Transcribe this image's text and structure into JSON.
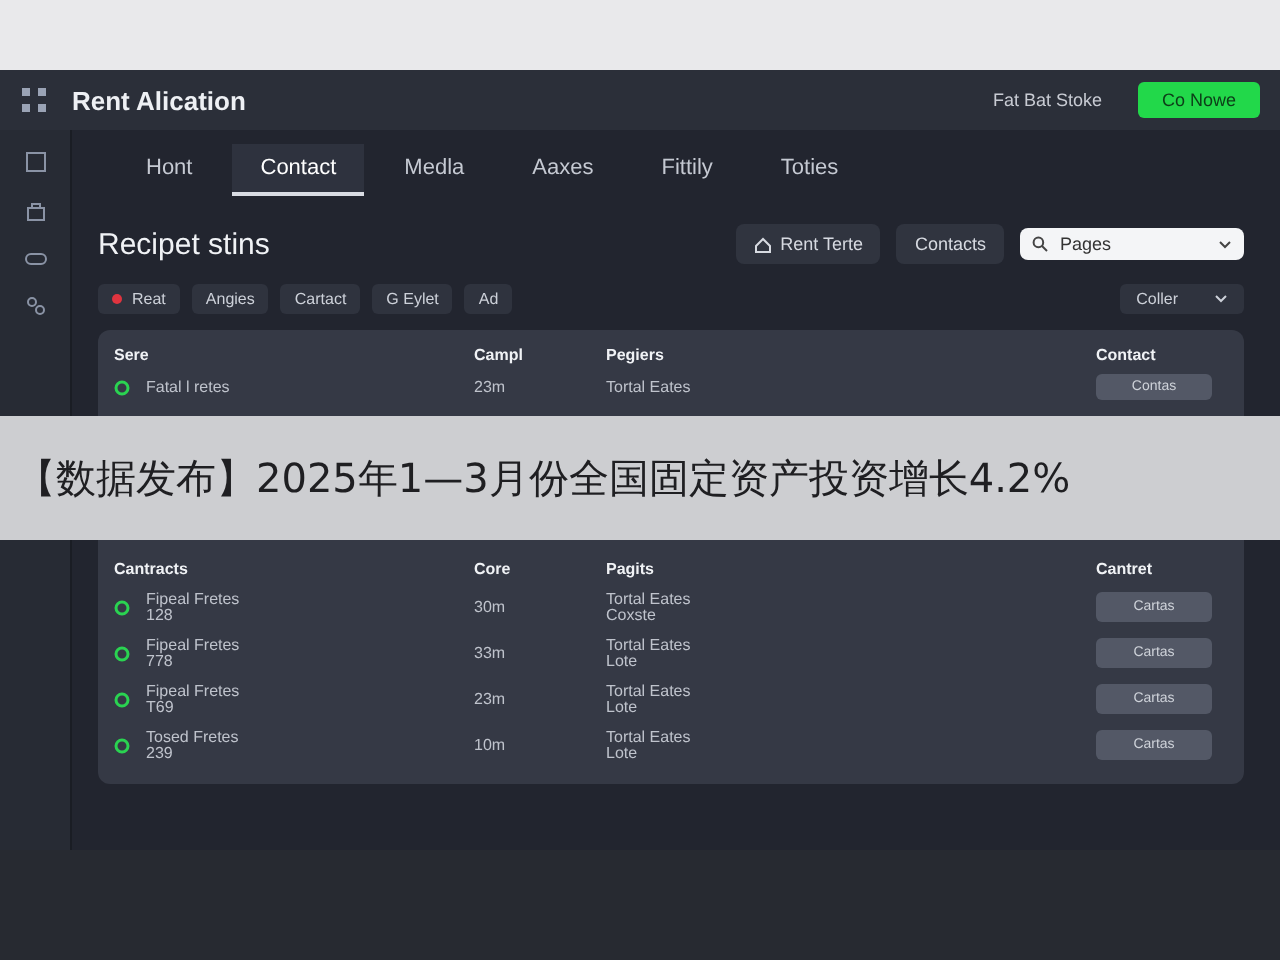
{
  "header": {
    "title": "Rent Alication",
    "link": "Fat Bat Stoke",
    "button": "Co Nowe"
  },
  "tabs": [
    {
      "label": "Hont",
      "selected": false
    },
    {
      "label": "Contact",
      "selected": true
    },
    {
      "label": "Medla",
      "selected": false
    },
    {
      "label": "Aaxes",
      "selected": false
    },
    {
      "label": "Fittily",
      "selected": false
    },
    {
      "label": "Toties",
      "selected": false
    }
  ],
  "page_title": "Recipet stins",
  "actions": [
    {
      "kind": "icon",
      "label": "Rent Terte"
    },
    {
      "kind": "plain",
      "label": "Contacts"
    }
  ],
  "search": {
    "value": "Pages"
  },
  "chips": [
    {
      "label": "Reat",
      "marker": true
    },
    {
      "label": "Angies",
      "marker": false
    },
    {
      "label": "Cartact",
      "marker": false
    },
    {
      "label": "G Eylet",
      "marker": false
    },
    {
      "label": "Ad",
      "marker": false
    }
  ],
  "sort": {
    "value": "Coller"
  },
  "table_1": {
    "columns": [
      "Sere",
      "Campl",
      "Pegiers",
      "Contact"
    ],
    "rows": [
      {
        "name": "Fatal l retes",
        "time": "23m",
        "region": "Tortal Eates",
        "action": "Contas"
      }
    ]
  },
  "banner": "【数据发布】2025年1—3月份全国固定资产投资增长4.2%",
  "table_2": {
    "columns": [
      "Cantracts",
      "Core",
      "Pagits",
      "Cantret"
    ],
    "rows": [
      {
        "name": "Fipeal Fretes",
        "code": "128",
        "time": "30m",
        "region": "Tortal Eates",
        "note": "Coxste",
        "action": "Cartas"
      },
      {
        "name": "Fipeal Fretes",
        "code": "778",
        "time": "33m",
        "region": "Tortal Eates",
        "note": "Lote",
        "action": "Cartas"
      },
      {
        "name": "Fipeal Fretes",
        "code": "T69",
        "time": "23m",
        "region": "Tortal Eates",
        "note": "Lote",
        "action": "Cartas"
      },
      {
        "name": "Tosed Fretes",
        "code": "239",
        "time": "10m",
        "region": "Tortal Eates",
        "note": "Lote",
        "action": "Cartas"
      }
    ]
  }
}
